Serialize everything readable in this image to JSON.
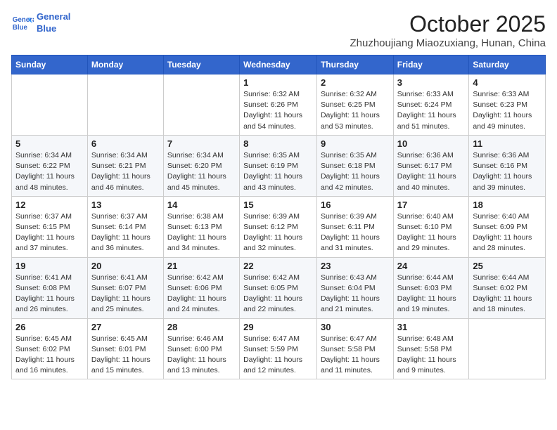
{
  "logo": {
    "line1": "General",
    "line2": "Blue"
  },
  "title": "October 2025",
  "location": "Zhuzhoujiang Miaozuxiang, Hunan, China",
  "weekdays": [
    "Sunday",
    "Monday",
    "Tuesday",
    "Wednesday",
    "Thursday",
    "Friday",
    "Saturday"
  ],
  "weeks": [
    [
      {
        "day": "",
        "info": ""
      },
      {
        "day": "",
        "info": ""
      },
      {
        "day": "",
        "info": ""
      },
      {
        "day": "1",
        "info": "Sunrise: 6:32 AM\nSunset: 6:26 PM\nDaylight: 11 hours\nand 54 minutes."
      },
      {
        "day": "2",
        "info": "Sunrise: 6:32 AM\nSunset: 6:25 PM\nDaylight: 11 hours\nand 53 minutes."
      },
      {
        "day": "3",
        "info": "Sunrise: 6:33 AM\nSunset: 6:24 PM\nDaylight: 11 hours\nand 51 minutes."
      },
      {
        "day": "4",
        "info": "Sunrise: 6:33 AM\nSunset: 6:23 PM\nDaylight: 11 hours\nand 49 minutes."
      }
    ],
    [
      {
        "day": "5",
        "info": "Sunrise: 6:34 AM\nSunset: 6:22 PM\nDaylight: 11 hours\nand 48 minutes."
      },
      {
        "day": "6",
        "info": "Sunrise: 6:34 AM\nSunset: 6:21 PM\nDaylight: 11 hours\nand 46 minutes."
      },
      {
        "day": "7",
        "info": "Sunrise: 6:34 AM\nSunset: 6:20 PM\nDaylight: 11 hours\nand 45 minutes."
      },
      {
        "day": "8",
        "info": "Sunrise: 6:35 AM\nSunset: 6:19 PM\nDaylight: 11 hours\nand 43 minutes."
      },
      {
        "day": "9",
        "info": "Sunrise: 6:35 AM\nSunset: 6:18 PM\nDaylight: 11 hours\nand 42 minutes."
      },
      {
        "day": "10",
        "info": "Sunrise: 6:36 AM\nSunset: 6:17 PM\nDaylight: 11 hours\nand 40 minutes."
      },
      {
        "day": "11",
        "info": "Sunrise: 6:36 AM\nSunset: 6:16 PM\nDaylight: 11 hours\nand 39 minutes."
      }
    ],
    [
      {
        "day": "12",
        "info": "Sunrise: 6:37 AM\nSunset: 6:15 PM\nDaylight: 11 hours\nand 37 minutes."
      },
      {
        "day": "13",
        "info": "Sunrise: 6:37 AM\nSunset: 6:14 PM\nDaylight: 11 hours\nand 36 minutes."
      },
      {
        "day": "14",
        "info": "Sunrise: 6:38 AM\nSunset: 6:13 PM\nDaylight: 11 hours\nand 34 minutes."
      },
      {
        "day": "15",
        "info": "Sunrise: 6:39 AM\nSunset: 6:12 PM\nDaylight: 11 hours\nand 32 minutes."
      },
      {
        "day": "16",
        "info": "Sunrise: 6:39 AM\nSunset: 6:11 PM\nDaylight: 11 hours\nand 31 minutes."
      },
      {
        "day": "17",
        "info": "Sunrise: 6:40 AM\nSunset: 6:10 PM\nDaylight: 11 hours\nand 29 minutes."
      },
      {
        "day": "18",
        "info": "Sunrise: 6:40 AM\nSunset: 6:09 PM\nDaylight: 11 hours\nand 28 minutes."
      }
    ],
    [
      {
        "day": "19",
        "info": "Sunrise: 6:41 AM\nSunset: 6:08 PM\nDaylight: 11 hours\nand 26 minutes."
      },
      {
        "day": "20",
        "info": "Sunrise: 6:41 AM\nSunset: 6:07 PM\nDaylight: 11 hours\nand 25 minutes."
      },
      {
        "day": "21",
        "info": "Sunrise: 6:42 AM\nSunset: 6:06 PM\nDaylight: 11 hours\nand 24 minutes."
      },
      {
        "day": "22",
        "info": "Sunrise: 6:42 AM\nSunset: 6:05 PM\nDaylight: 11 hours\nand 22 minutes."
      },
      {
        "day": "23",
        "info": "Sunrise: 6:43 AM\nSunset: 6:04 PM\nDaylight: 11 hours\nand 21 minutes."
      },
      {
        "day": "24",
        "info": "Sunrise: 6:44 AM\nSunset: 6:03 PM\nDaylight: 11 hours\nand 19 minutes."
      },
      {
        "day": "25",
        "info": "Sunrise: 6:44 AM\nSunset: 6:02 PM\nDaylight: 11 hours\nand 18 minutes."
      }
    ],
    [
      {
        "day": "26",
        "info": "Sunrise: 6:45 AM\nSunset: 6:02 PM\nDaylight: 11 hours\nand 16 minutes."
      },
      {
        "day": "27",
        "info": "Sunrise: 6:45 AM\nSunset: 6:01 PM\nDaylight: 11 hours\nand 15 minutes."
      },
      {
        "day": "28",
        "info": "Sunrise: 6:46 AM\nSunset: 6:00 PM\nDaylight: 11 hours\nand 13 minutes."
      },
      {
        "day": "29",
        "info": "Sunrise: 6:47 AM\nSunset: 5:59 PM\nDaylight: 11 hours\nand 12 minutes."
      },
      {
        "day": "30",
        "info": "Sunrise: 6:47 AM\nSunset: 5:58 PM\nDaylight: 11 hours\nand 11 minutes."
      },
      {
        "day": "31",
        "info": "Sunrise: 6:48 AM\nSunset: 5:58 PM\nDaylight: 11 hours\nand 9 minutes."
      },
      {
        "day": "",
        "info": ""
      }
    ]
  ]
}
